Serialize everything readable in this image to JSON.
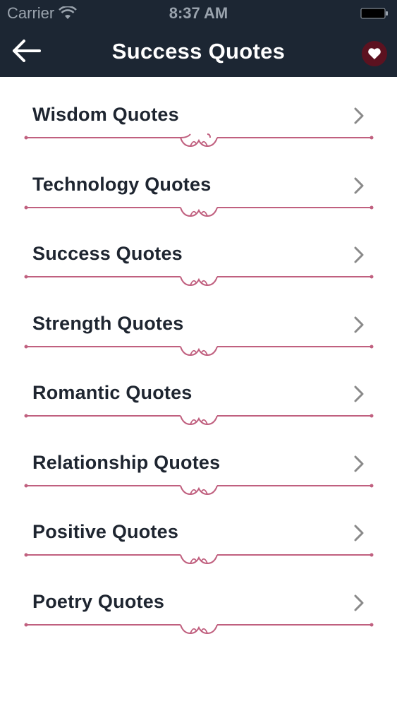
{
  "status_bar": {
    "carrier": "Carrier",
    "time": "8:37 AM"
  },
  "nav": {
    "title": "Success Quotes",
    "back_icon": "arrow-left-icon",
    "favorite_icon": "heart-icon"
  },
  "colors": {
    "navbar_bg": "#1c2633",
    "divider": "#c0607f",
    "text": "#1e2530",
    "chevron": "#8a8a8a",
    "favorite_bg": "#5c1220"
  },
  "categories": [
    {
      "label": "Wisdom Quotes"
    },
    {
      "label": "Technology Quotes"
    },
    {
      "label": "Success Quotes"
    },
    {
      "label": "Strength Quotes"
    },
    {
      "label": "Romantic Quotes"
    },
    {
      "label": "Relationship Quotes"
    },
    {
      "label": "Positive Quotes"
    },
    {
      "label": "Poetry Quotes"
    }
  ]
}
